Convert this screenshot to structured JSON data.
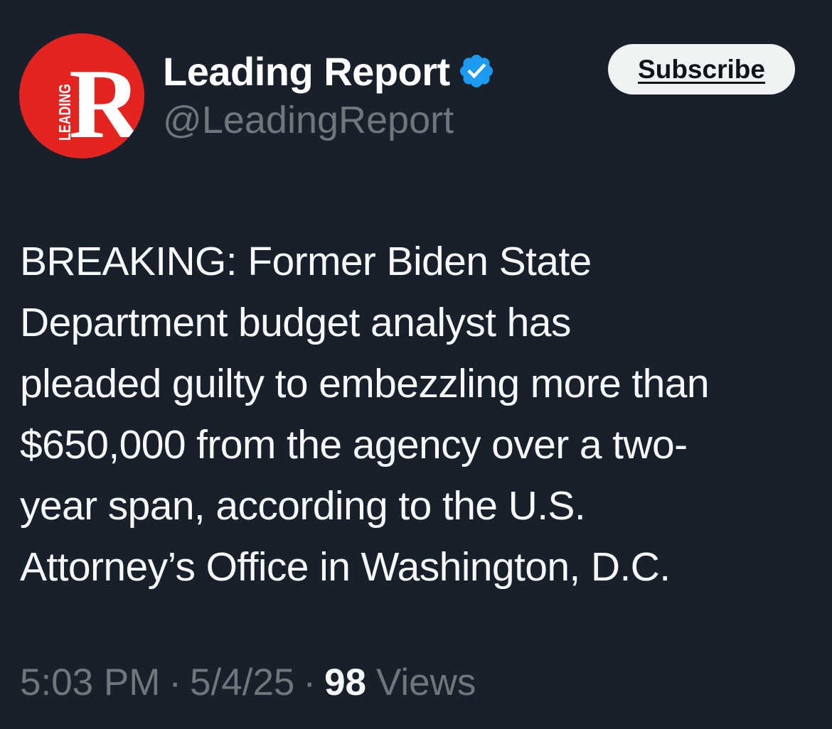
{
  "author": {
    "display_name": "Leading Report",
    "handle": "@LeadingReport",
    "avatar_letter": "R",
    "avatar_side_text": "LEADING",
    "avatar_color": "#e3241f",
    "verified_color": "#1d9bf0"
  },
  "subscribe_label": "Subscribe",
  "tweet": {
    "lines": [
      "BREAKING: Former Biden State",
      "Department budget analyst has",
      "pleaded guilty to embezzling more than",
      "$650,000 from the agency over a two-",
      "year span, according to the U.S.",
      "Attorney’s Office in Washington, D.C."
    ]
  },
  "meta": {
    "time": "5:03 PM",
    "separator": "·",
    "date": "5/4/25",
    "views_count": "98",
    "views_label": "Views"
  }
}
